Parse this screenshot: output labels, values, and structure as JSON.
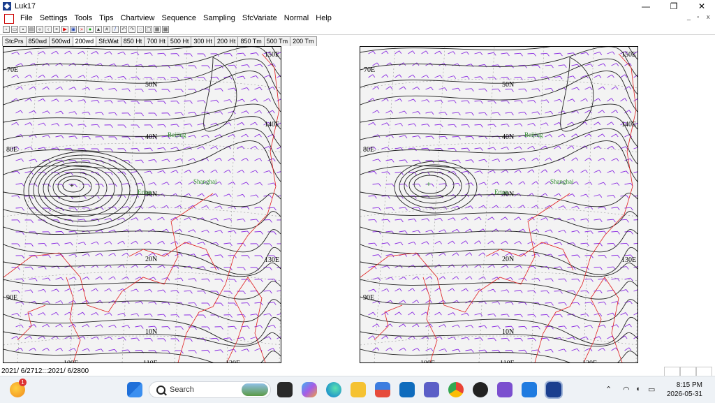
{
  "window": {
    "title": "Luk17",
    "minimize": "—",
    "restore": "❐",
    "close": "✕"
  },
  "mdi": {
    "minimize": "_",
    "restore": "▫",
    "close": "x"
  },
  "menu": [
    "File",
    "Settings",
    "Tools",
    "Tips",
    "Chartview",
    "Sequence",
    "Sampling",
    "SfcVariate",
    "Normal",
    "Help"
  ],
  "toolbar_icons": [
    "new-file-icon",
    "open-folder-icon",
    "save-icon",
    "print-icon",
    "first-frame-icon",
    "previous-frame-icon",
    "stop-icon",
    "play-icon",
    "step-icon",
    "fast-forward-icon",
    "globe-icon",
    "up-arrow-icon",
    "grid-icon",
    "pen-icon",
    "undo-icon",
    "redo-icon",
    "zoom-icon",
    "window-icon",
    "picture-icon",
    "map-grid-icon"
  ],
  "tabs": [
    "StcPrs",
    "850wd",
    "500wd",
    "200wd",
    "SfcWat",
    "850 Ht",
    "700 Ht",
    "500 Ht",
    "300 Ht",
    "200 Ht",
    "850 Tm",
    "500 Tm",
    "200 Tm"
  ],
  "active_tab": "200wd",
  "maps": [
    {
      "longitude_labels": [
        "70E",
        "80E",
        "90E",
        "100E",
        "110E",
        "120E",
        "130E",
        "140E",
        "150E"
      ],
      "latitude_labels": [
        "50N",
        "40N",
        "30N",
        "20N",
        "10N"
      ],
      "cities": [
        "Beijing",
        "Shanghai",
        "Ertan"
      ]
    },
    {
      "longitude_labels": [
        "70E",
        "80E",
        "90E",
        "100E",
        "110E",
        "120E",
        "130E",
        "140E",
        "150E"
      ],
      "latitude_labels": [
        "50N",
        "40N",
        "30N",
        "20N",
        "10N"
      ],
      "cities": [
        "Beijing",
        "Shanghai",
        "Ertan"
      ]
    }
  ],
  "colors": {
    "contour": "#222222",
    "barb": "#8a2be2",
    "coast": "#e02020",
    "city": "#2e8b2e",
    "grid": "#999999",
    "map_bg": "#f3f3f3"
  },
  "status": {
    "text": "2021/ 6/2712:::2021/ 6/2800"
  },
  "taskbar": {
    "search_placeholder": "Search",
    "weather_badge": "1",
    "time": "8:15 PM",
    "date": "2026-05-31",
    "apps": [
      "windows-start-icon",
      "file-explorer-square-icon",
      "copilot-icon",
      "edge-icon",
      "folder-icon",
      "store-icon",
      "outlook-icon",
      "teams-icon",
      "chrome-icon",
      "media-player-icon",
      "visual-studio-icon",
      "blue-app-icon",
      "luk17-icon"
    ]
  }
}
